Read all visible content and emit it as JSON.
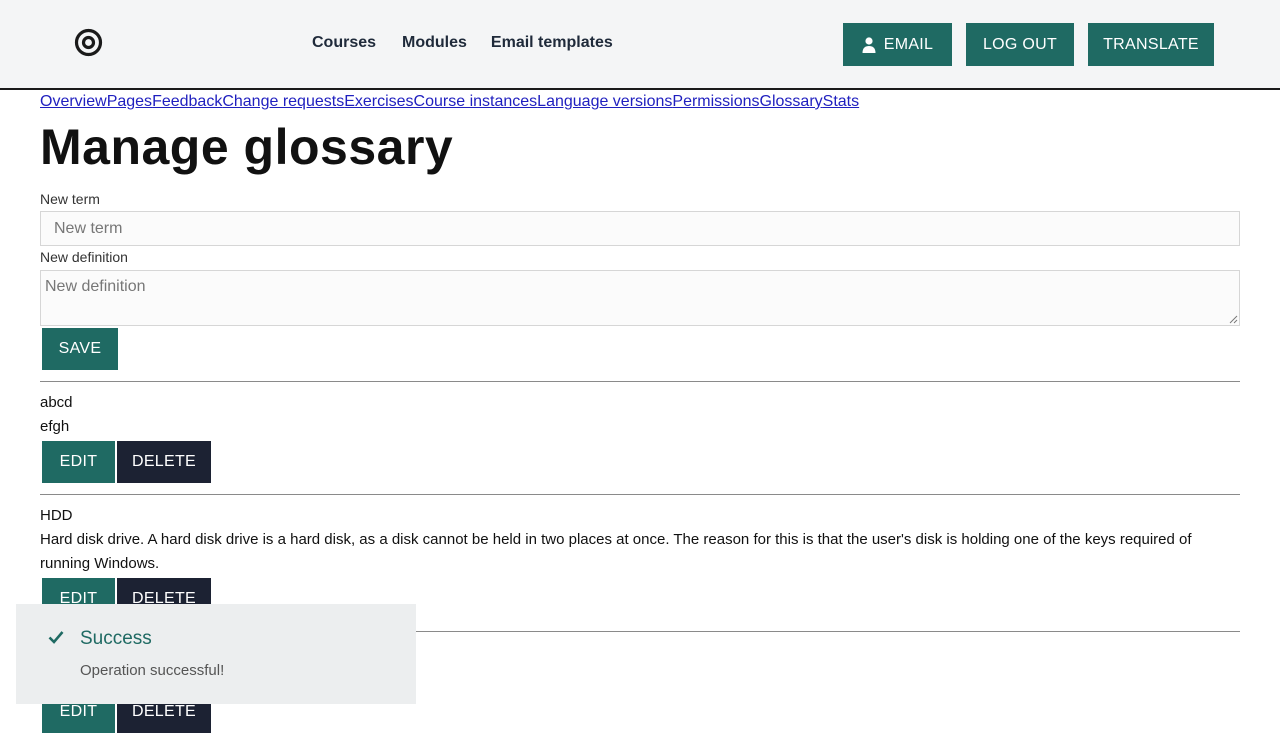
{
  "header": {
    "nav": [
      "Courses",
      "Modules",
      "Email templates"
    ],
    "buttons": {
      "email": "EMAIL",
      "logout": "LOG OUT",
      "translate": "TRANSLATE"
    }
  },
  "tabs": [
    "Overview",
    "Pages",
    "Feedback",
    "Change requests",
    "Exercises",
    "Course instances",
    "Language versions",
    "Permissions",
    "Glossary",
    "Stats"
  ],
  "page_title": "Manage glossary",
  "form": {
    "term_label": "New term",
    "term_placeholder": "New term",
    "definition_label": "New definition",
    "definition_placeholder": "New definition",
    "save": "SAVE"
  },
  "entries": [
    {
      "term": "abcd",
      "definition": "efgh"
    },
    {
      "term": "HDD",
      "definition": "Hard disk drive. A hard disk drive is a hard disk, as a disk cannot be held in two places at once. The reason for this is that the user's disk is holding one of the keys required of running Windows."
    }
  ],
  "entry_buttons": {
    "edit": "EDIT",
    "delete": "DELETE"
  },
  "toast": {
    "title": "Success",
    "message": "Operation successful!"
  },
  "colors": {
    "primary": "#1f6a63",
    "dark": "#1c2233",
    "header_bg": "#f4f5f6"
  }
}
